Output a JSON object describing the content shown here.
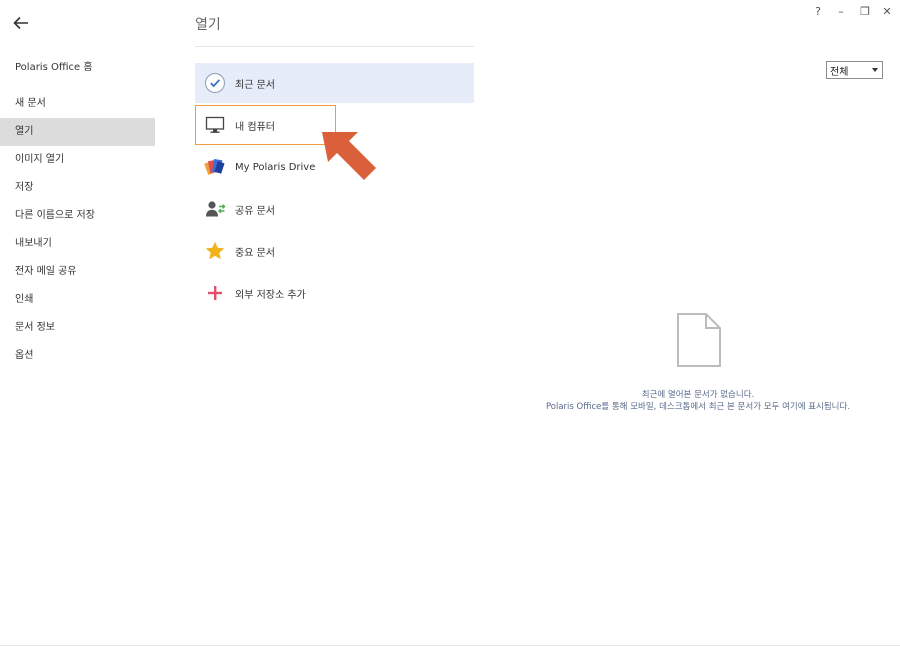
{
  "sidebar": {
    "items": [
      {
        "label": "Polaris Office 홈"
      },
      {
        "label": "새 문서"
      },
      {
        "label": "열기"
      },
      {
        "label": "이미지 열기"
      },
      {
        "label": "저장"
      },
      {
        "label": "다른 이름으로 저장"
      },
      {
        "label": "내보내기"
      },
      {
        "label": "전자 메일 공유"
      },
      {
        "label": "인쇄"
      },
      {
        "label": "문서 정보"
      },
      {
        "label": "옵션"
      }
    ],
    "active_index": 2
  },
  "main": {
    "title": "열기",
    "open_locations": [
      {
        "label": "최근 문서",
        "icon": "check-circle-icon"
      },
      {
        "label": "내 컴퓨터",
        "icon": "monitor-icon"
      },
      {
        "label": "My Polaris Drive",
        "icon": "polaris-drive-icon"
      },
      {
        "label": "공유 문서",
        "icon": "shared-user-icon"
      },
      {
        "label": "중요 문서",
        "icon": "star-icon"
      },
      {
        "label": "외부 저장소 추가",
        "icon": "plus-icon"
      }
    ],
    "selected_index": 0,
    "focused_index": 1
  },
  "window_controls": {
    "help": "?",
    "minimize": "–",
    "restore": "❐",
    "close": "✕"
  },
  "filter": {
    "selected": "전체"
  },
  "empty_state": {
    "line1": "최근에 열어본 문서가 없습니다.",
    "line2": "Polaris Office를 통해 모바일, 데스크톱에서 최근 본 문서가 모두 여기에 표시됩니다."
  },
  "colors": {
    "accent_selected_bg": "#e6edf9",
    "focus_border": "#f29a3f",
    "annotation_arrow": "#d9603b",
    "active_sidebar_bg": "#dcdcdc"
  }
}
